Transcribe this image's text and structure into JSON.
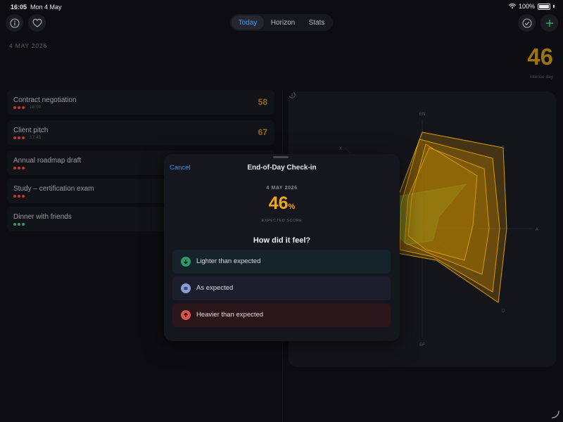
{
  "status_bar": {
    "time": "16:05",
    "date": "Mon 4 May",
    "battery": "100%"
  },
  "toolbar": {
    "tabs": [
      {
        "label": "Today",
        "active": true
      },
      {
        "label": "Horizon",
        "active": false
      },
      {
        "label": "Stats",
        "active": false
      }
    ]
  },
  "header": {
    "date": "4 MAY 2026",
    "score": "46",
    "score_caption": "Intense day"
  },
  "tasks": [
    {
      "title": "Contract negotiation",
      "time": "16:00",
      "score": "58",
      "dots": [
        "#c0392b",
        "#c0392b",
        "#c0392b"
      ]
    },
    {
      "title": "Client pitch",
      "time": "17:45",
      "score": "67",
      "dots": [
        "#c0392b",
        "#c0392b",
        "#c0392b"
      ]
    },
    {
      "title": "Annual roadmap draft",
      "time": "",
      "score": "",
      "dots": [
        "#c0392b",
        "#c0392b",
        "#c0392b"
      ]
    },
    {
      "title": "Study – certification exam",
      "time": "",
      "score": "",
      "dots": [
        "#c0392b",
        "#c0392b",
        "#c0392b"
      ]
    },
    {
      "title": "Dinner with friends",
      "time": "",
      "score": "",
      "dots": [
        "#2e9a6a",
        "#2e9a6a",
        "#2e9a6a"
      ]
    }
  ],
  "radar": {
    "axis_labels": {
      "top": "EN",
      "top_left": "X",
      "top_right": "E",
      "right": "A",
      "bottom_right": "U",
      "bottom": "EF"
    }
  },
  "modal": {
    "cancel_label": "Cancel",
    "title": "End-of-Day Check-in",
    "date": "4 MAY 2026",
    "score": "46",
    "score_unit": "%",
    "score_caption": "EXPECTED SCORE",
    "question": "How did it feel?",
    "options": [
      {
        "label": "Lighter than expected",
        "icon": "arrow-down-icon",
        "color": "#2e9a6a",
        "bg": "#15242a"
      },
      {
        "label": "As expected",
        "icon": "equals-icon",
        "color": "#8a9bd6",
        "bg": "#1c1e2c"
      },
      {
        "label": "Heavier than expected",
        "icon": "arrow-up-icon",
        "color": "#d9534f",
        "bg": "#2a151b"
      }
    ]
  },
  "colors": {
    "accent": "#3aa0ff",
    "score": "#f0a81b",
    "radar_fill": "#c58a00"
  }
}
